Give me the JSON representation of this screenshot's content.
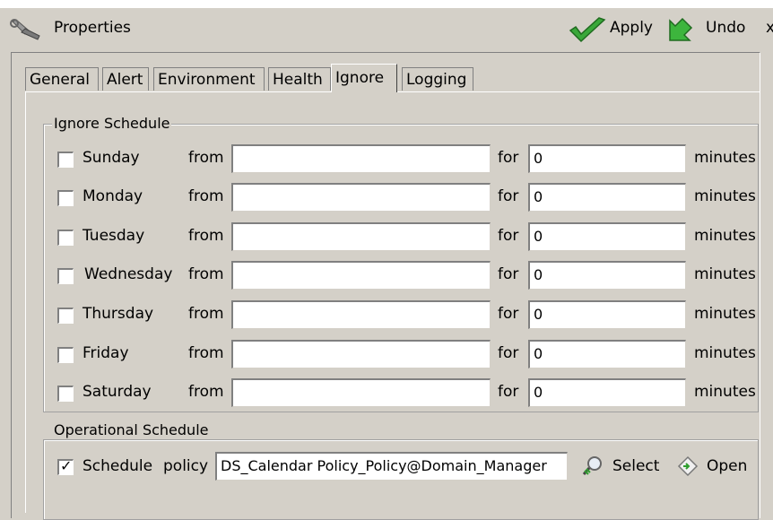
{
  "window": {
    "title": "Properties",
    "icon": "wrench-icon"
  },
  "toolbar": {
    "apply_label": "Apply",
    "undo_label": "Undo",
    "close_label": "x"
  },
  "tabs": [
    {
      "label": "General"
    },
    {
      "label": "Alert"
    },
    {
      "label": "Environment"
    },
    {
      "label": "Health"
    },
    {
      "label": "Ignore",
      "active": true
    },
    {
      "label": "Logging"
    }
  ],
  "ignore_schedule": {
    "legend": "Ignore Schedule",
    "from_label": "from",
    "for_label": "for",
    "minutes_label": "minutes",
    "days": [
      {
        "day": "Sunday",
        "checked": false,
        "from": "",
        "for": "0"
      },
      {
        "day": "Monday",
        "checked": false,
        "from": "",
        "for": "0"
      },
      {
        "day": "Tuesday",
        "checked": false,
        "from": "",
        "for": "0"
      },
      {
        "day": "Wednesday",
        "checked": false,
        "from": "",
        "for": "0"
      },
      {
        "day": "Thursday",
        "checked": false,
        "from": "",
        "for": "0"
      },
      {
        "day": "Friday",
        "checked": false,
        "from": "",
        "for": "0"
      },
      {
        "day": "Saturday",
        "checked": false,
        "from": "",
        "for": "0"
      }
    ]
  },
  "operational_schedule": {
    "legend": "Operational Schedule",
    "schedule_label": "Schedule",
    "schedule_checked": true,
    "policy_label": "policy",
    "policy_value": "DS_Calendar Policy_Policy@Domain_Manager",
    "select_label": "Select",
    "open_label": "Open"
  },
  "colors": {
    "background": "#d4d0c8",
    "accent_green": "#2e9e2e"
  }
}
